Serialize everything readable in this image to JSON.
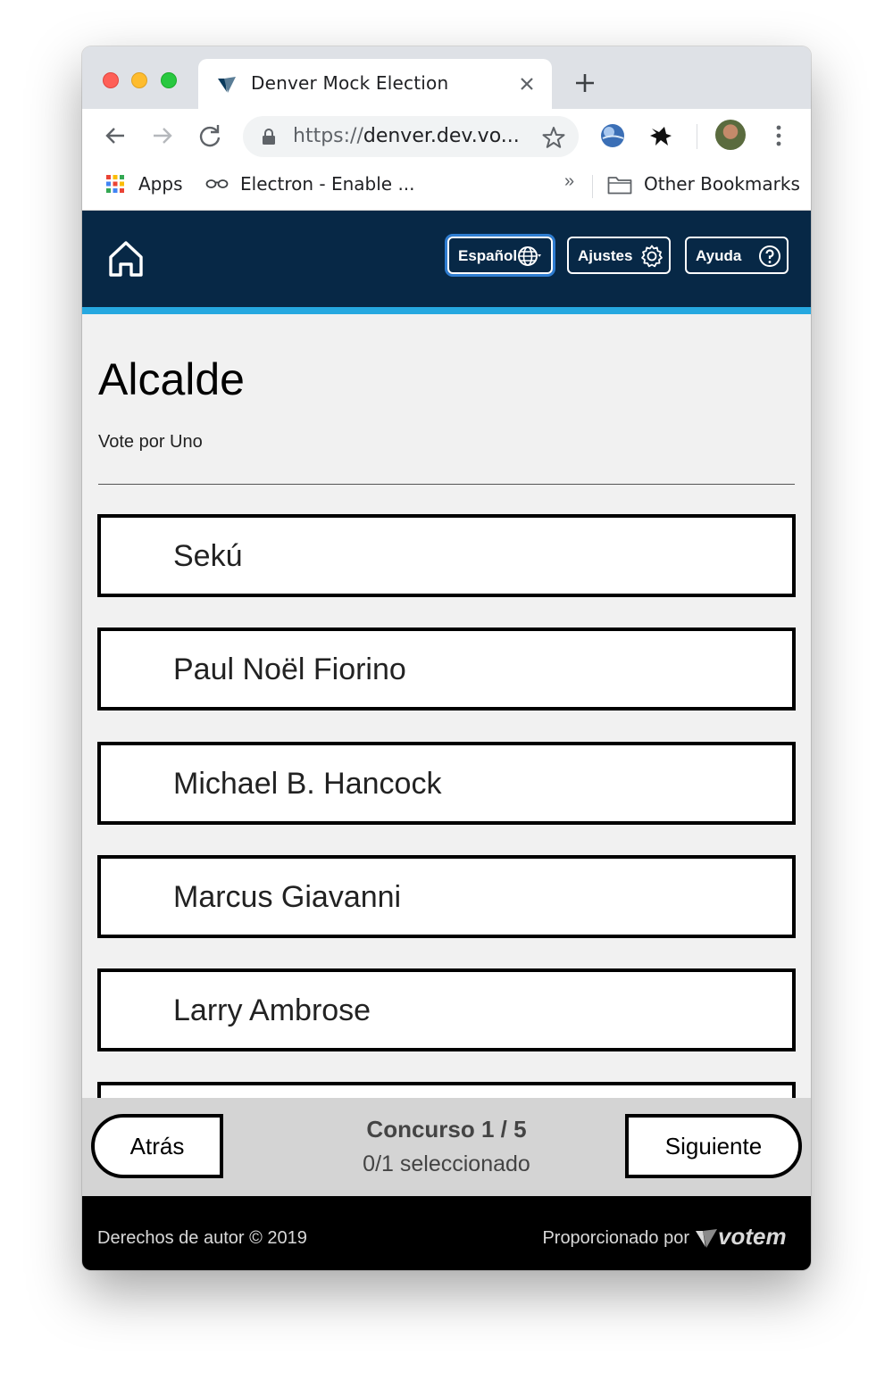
{
  "browser": {
    "tab": {
      "title": "Denver Mock Election"
    },
    "omnibox": {
      "protocol": "https://",
      "host": "denver.dev.vo..."
    },
    "bookmarks": {
      "apps_label": "Apps",
      "item_1_label": "Electron - Enable ...",
      "overflow_label": "»",
      "other_label": "Other Bookmarks"
    }
  },
  "header": {
    "language_label": "Español",
    "settings_label": "Ajustes",
    "help_label": "Ayuda",
    "bg_color": "#072846",
    "accent_color": "#26a8e0"
  },
  "contest": {
    "title": "Alcalde",
    "instructions": "Vote por Uno",
    "candidates": [
      {
        "name": "Sekú"
      },
      {
        "name": "Paul Noël Fiorino"
      },
      {
        "name": "Michael B. Hancock"
      },
      {
        "name": "Marcus Giavanni"
      },
      {
        "name": "Larry Ambrose"
      },
      {
        "name": ""
      }
    ]
  },
  "nav": {
    "back_label": "Atrás",
    "next_label": "Siguiente",
    "progress_title": "Concurso 1 / 5",
    "progress_status": "0/1 seleccionado"
  },
  "footer": {
    "copyright": "Derechos de autor © 2019",
    "powered_by": "Proporcionado por",
    "brand": "votem"
  }
}
